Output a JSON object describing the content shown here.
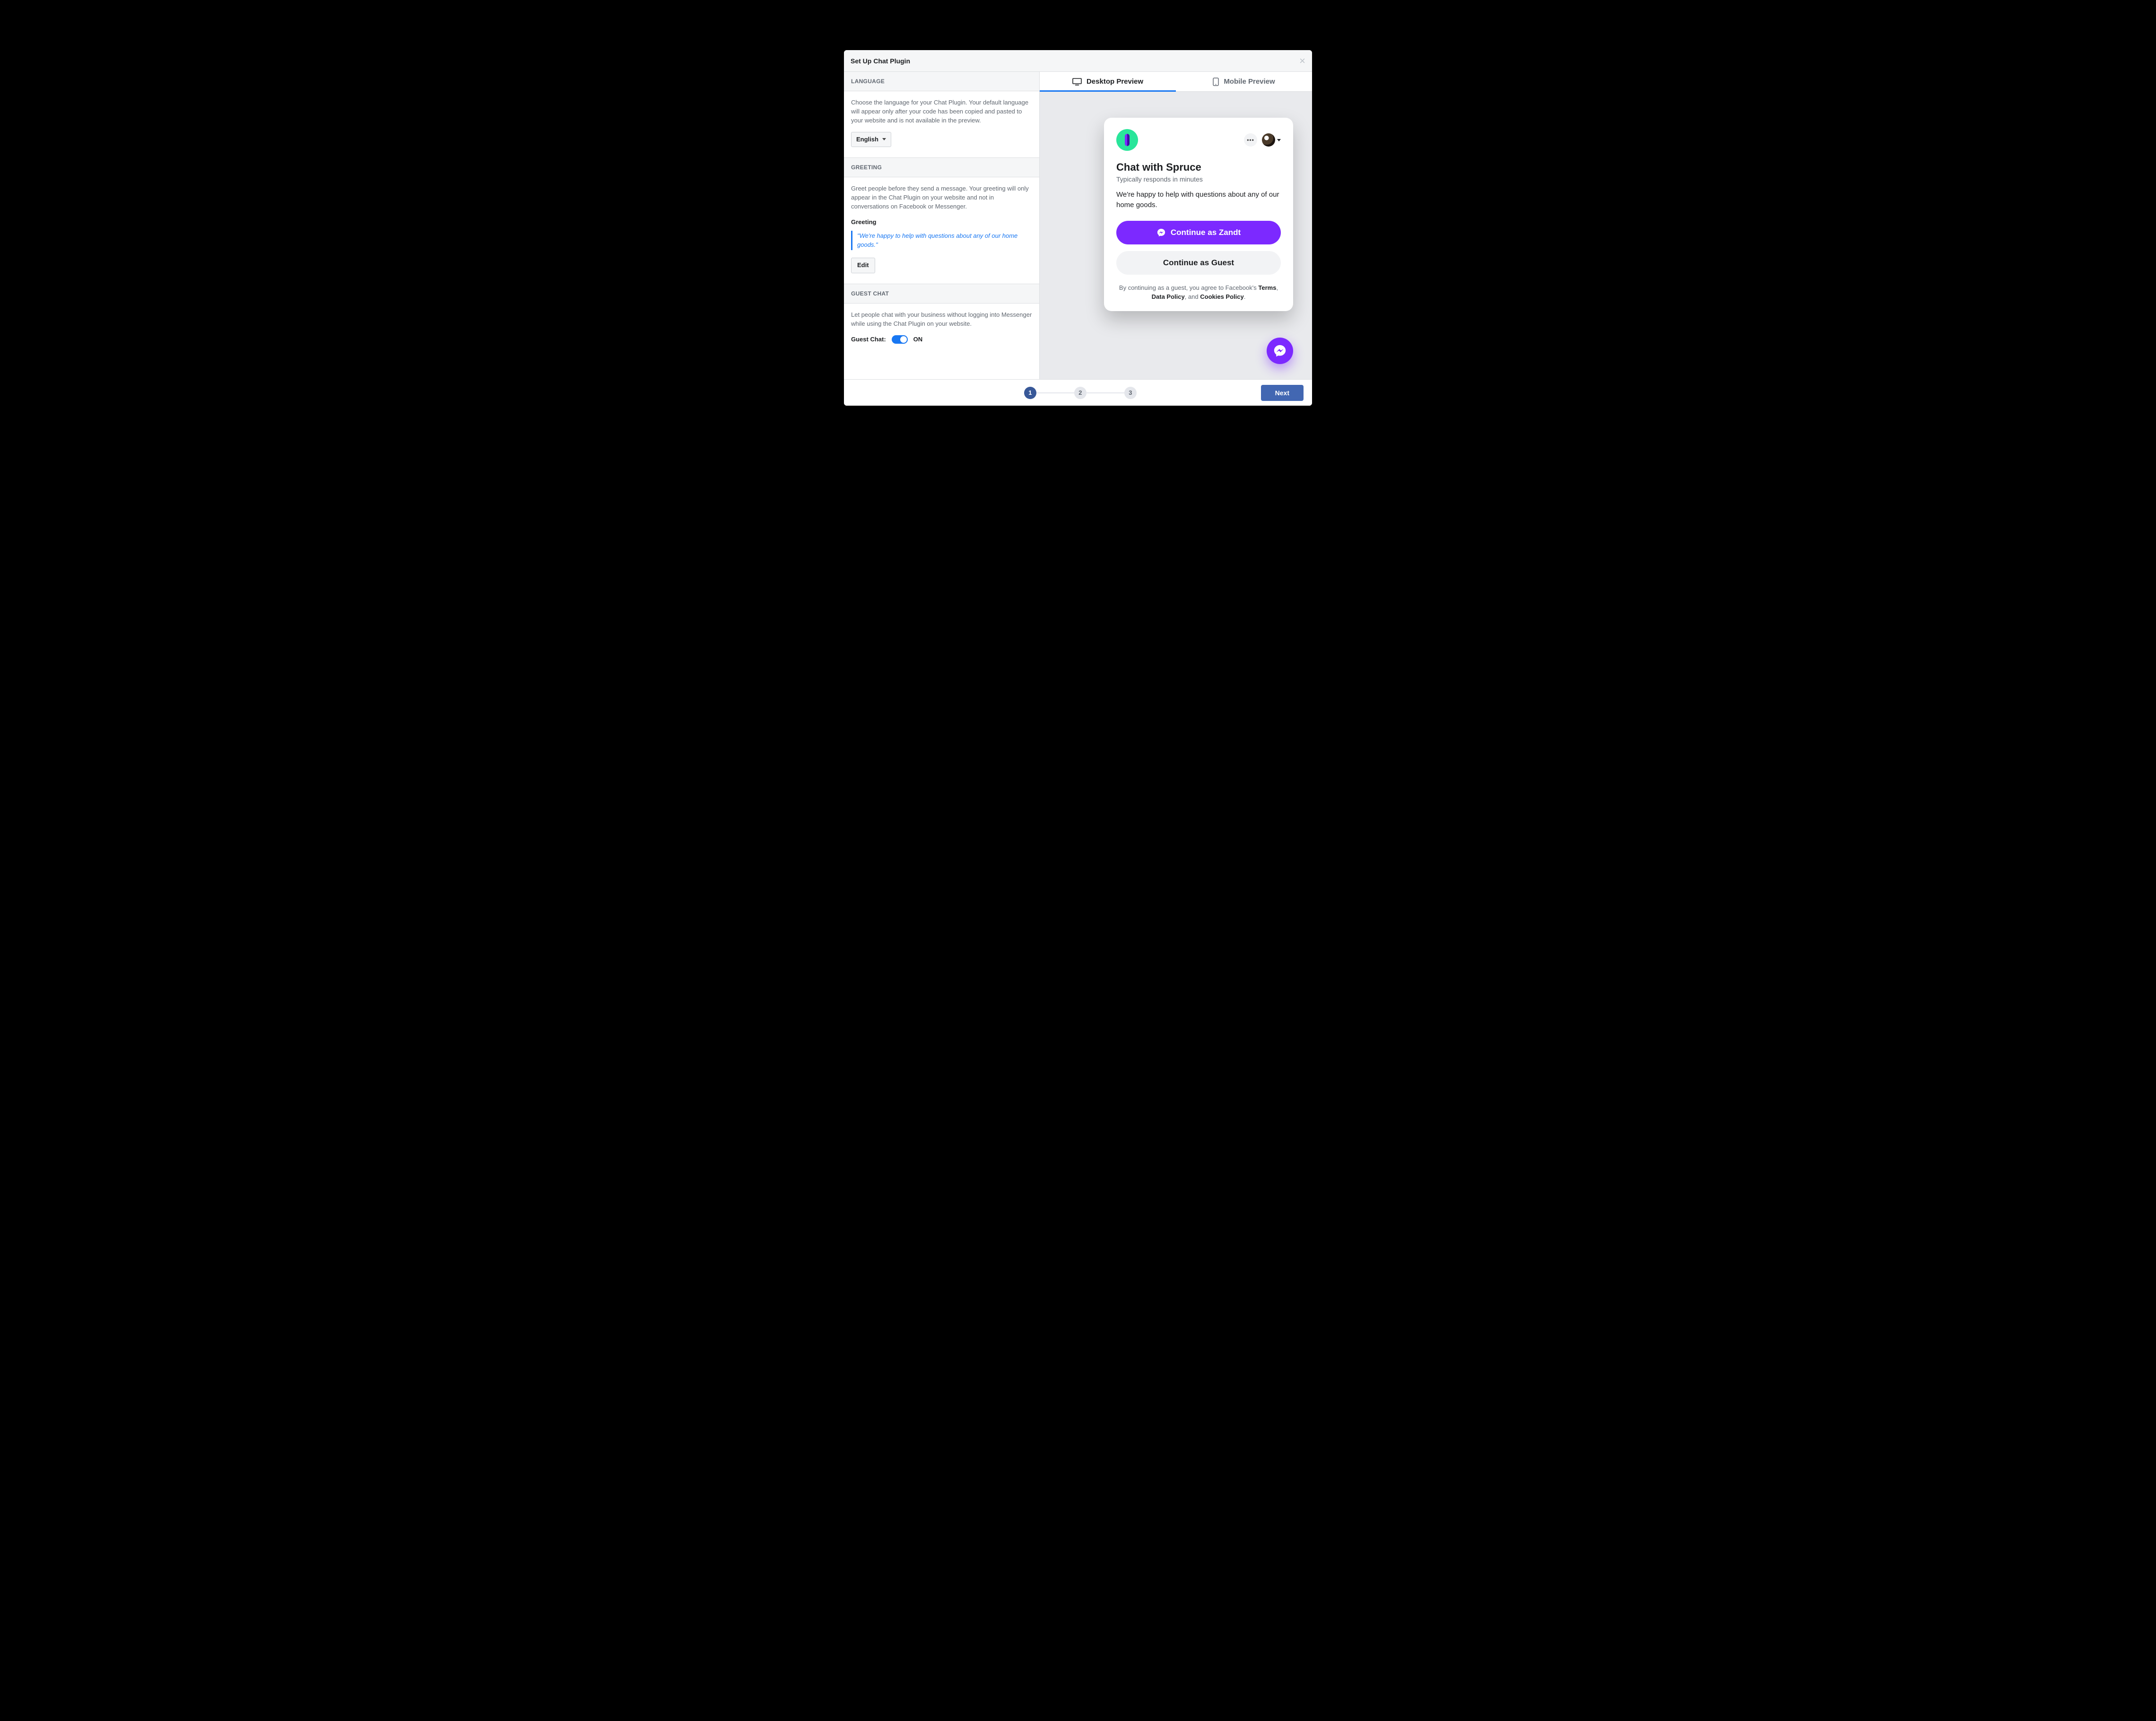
{
  "modal": {
    "title": "Set Up Chat Plugin"
  },
  "language": {
    "header": "LANGUAGE",
    "desc": "Choose the language for your Chat Plugin. Your default language will appear only after your code has been copied and pasted to your website and is not available in the preview.",
    "selected": "English"
  },
  "greeting": {
    "header": "GREETING",
    "desc": "Greet people before they send a message. Your greeting will only appear in the Chat Plugin on your website and not in conversations on Facebook or Messenger.",
    "field_label": "Greeting",
    "value": "\"We're happy to help with questions about any of our home goods.\"",
    "edit_label": "Edit"
  },
  "guest_chat": {
    "header": "GUEST CHAT",
    "desc": "Let people chat with your business without logging into Messenger while using the Chat Plugin on your website.",
    "label": "Guest Chat:",
    "state": "ON"
  },
  "preview": {
    "tabs": {
      "desktop": "Desktop Preview",
      "mobile": "Mobile Preview"
    },
    "card": {
      "title": "Chat with Spruce",
      "subtitle": "Typically responds in minutes",
      "message": "We're happy to help with questions about any of our home goods.",
      "continue_user": "Continue as Zandt",
      "continue_guest": "Continue as Guest",
      "legal_prefix": "By continuing as a guest, you agree to Facebook's ",
      "terms": "Terms",
      "sep1": ", ",
      "data_policy": "Data Policy",
      "sep2": ", and ",
      "cookies_policy": "Cookies Policy",
      "legal_suffix": "."
    }
  },
  "footer": {
    "next_label": "Next",
    "steps": [
      "1",
      "2",
      "3"
    ],
    "active_step_index": 0
  },
  "colors": {
    "accent": "#7c29ff",
    "link": "#1877f2"
  }
}
